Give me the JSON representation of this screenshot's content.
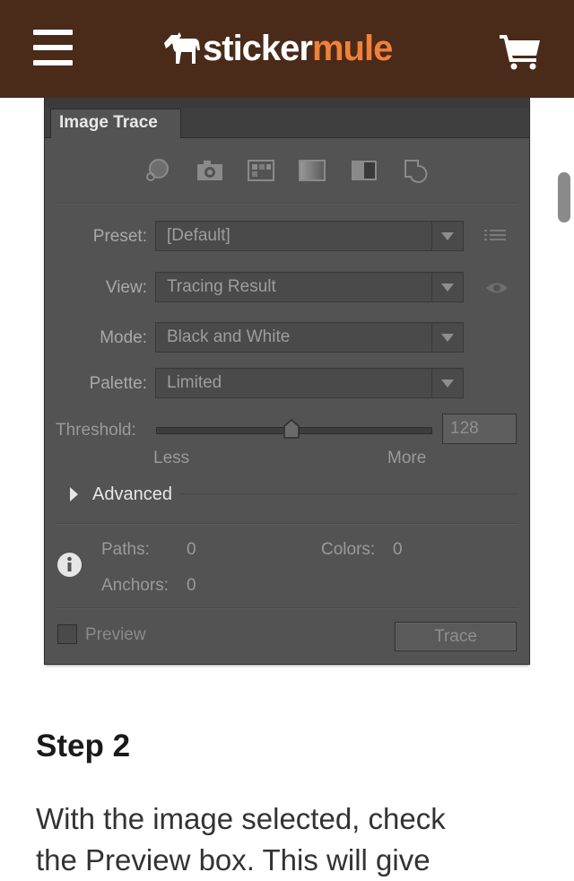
{
  "header": {
    "logo_part1": "sticker",
    "logo_part2": "mule",
    "icons": {
      "menu": "hamburger-menu-icon",
      "logo": "mule-horse-logo-icon",
      "cart": "shopping-cart-icon"
    },
    "colors": {
      "background": "#4a2a19",
      "logo_accent": "#f0813a"
    }
  },
  "panel": {
    "tab_title": "Image Trace",
    "toolbar_icons": [
      "auto-color-icon",
      "high-color-icon",
      "low-color-icon",
      "grayscale-icon",
      "black-and-white-icon",
      "outline-icon"
    ],
    "preset": {
      "label": "Preset:",
      "value": "[Default]"
    },
    "view": {
      "label": "View:",
      "value": "Tracing Result"
    },
    "mode": {
      "label": "Mode:",
      "value": "Black and White"
    },
    "palette": {
      "label": "Palette:",
      "value": "Limited"
    },
    "threshold": {
      "label": "Threshold:",
      "value": "128",
      "min_label": "Less",
      "max_label": "More",
      "level_fraction": 0.5
    },
    "advanced_label": "Advanced",
    "stats": {
      "paths_label": "Paths:",
      "paths_value": "0",
      "colors_label": "Colors:",
      "colors_value": "0",
      "anchors_label": "Anchors:",
      "anchors_value": "0"
    },
    "preview_label": "Preview",
    "trace_label": "Trace",
    "colors": {
      "panel_bg": "#535353",
      "text": "#a9a9a9"
    }
  },
  "article": {
    "step_title": "Step 2",
    "body_visible": "With the image selected, check",
    "body_cut": "the Preview box. This will give"
  }
}
